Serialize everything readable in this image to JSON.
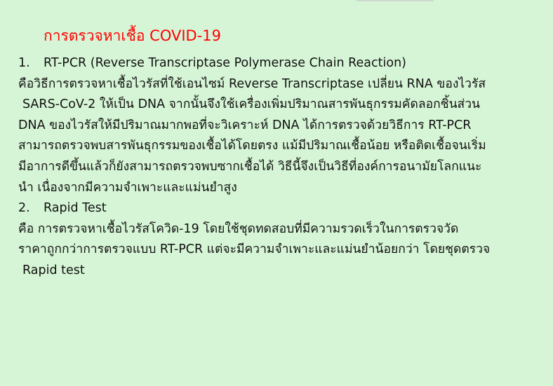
{
  "heading": "การตรวจหาเชื้อ COVID-19",
  "section1": {
    "number": "1.",
    "title": "RT-PCR (Reverse Transcriptase Polymerase Chain Reaction)",
    "lines": [
      "คือวิธีการตรวจหาเชื้อไวรัสที่ใช้เอนไซม์ Reverse Transcriptase เปลี่ยน RNA ของไวรัส",
      "SARS-CoV-2 ให้เป็น DNA จากนั้นจึงใช้เครื่องเพิ่มปริมาณสารพันธุกรรมคัดลอกชิ้นส่วน",
      "DNA ของไวรัสให้มีปริมาณมากพอที่จะวิเคราะห์ DNA ได้การตรวจด้วยวิธีการ RT-PCR",
      "สามารถตรวจพบสารพันธุกรรมของเชื้อได้โดยตรง แม้มีปริมาณเชื้อน้อย หรือติดเชื้อจนเริ่ม",
      "มีอาการดีขึ้นแล้วก็ยังสามารถตรวจพบซากเชื้อได้ วิธีนี้จึงเป็นวิธีที่องค์การอนามัยโลกแนะ",
      "นำ เนื่องจากมีความจำเพาะและแม่นยำสูง"
    ]
  },
  "section2": {
    "number": "2.",
    "title": "Rapid Test",
    "lines": [
      "คือ การตรวจหาเชื้อไวรัสโควิด-19 โดยใช้ชุดทดสอบที่มีความรวดเร็วในการตรวจวัด",
      "ราคาถูกกว่าการตรวจแบบ RT-PCR แต่จะมีความจำเพาะและแม่นยำน้อยกว่า โดยชุดตรวจ",
      "Rapid test"
    ]
  }
}
